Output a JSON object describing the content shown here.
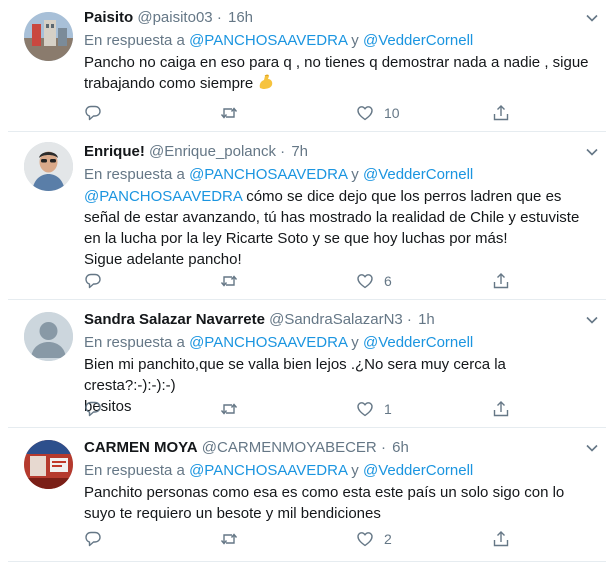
{
  "reply_prefix": "En respuesta a",
  "reply_joiner": "y",
  "tweets": [
    {
      "name": "Paisito",
      "handle": "@paisito03",
      "dot": "·",
      "time": "16h",
      "mentions": [
        "@PANCHOSAAVEDRA",
        "@VedderCornell"
      ],
      "text": "Pancho no caiga en eso para q , no tienes q demostrar nada a nadie , sigue trabajando como siempre",
      "emoji_icon": "flexed-biceps-icon",
      "like_count": "10",
      "avatar_color": "#b5504a"
    },
    {
      "name": "Enrique!",
      "handle": "@Enrique_polanck",
      "dot": "·",
      "time": "7h",
      "mentions": [
        "@PANCHOSAAVEDRA",
        "@VedderCornell"
      ],
      "text_mention": "@PANCHOSAAVEDRA",
      "text": " cómo se dice dejo que los perros ladren que es señal de estar avanzando, tú has mostrado la realidad de Chile y estuviste en la lucha por la ley Ricarte Soto y se que hoy luchas por más!\nSigue adelante pancho!",
      "like_count": "6",
      "avatar_color": "#d9dde0"
    },
    {
      "name": "Sandra Salazar Navarrete",
      "handle": "@SandraSalazarN3",
      "dot": "·",
      "time": "1h",
      "mentions": [
        "@PANCHOSAAVEDRA",
        "@VedderCornell"
      ],
      "text": "Bien mi panchito,que se valla bien lejos .¿No sera muy cerca la cresta?:-):-):-)\nbesitos",
      "like_count": "1",
      "avatar_color": "#ccd6dd"
    },
    {
      "name": "CARMEN MOYA",
      "handle": "@CARMENMOYABECER",
      "dot": "·",
      "time": "6h",
      "mentions": [
        "@PANCHOSAAVEDRA",
        "@VedderCornell"
      ],
      "text": "Panchito personas como esa es como esta este país un solo sigo con lo suyo te requiero un besote y mil bendiciones",
      "like_count": "2",
      "avatar_color": "#c0392b"
    }
  ],
  "icons": {
    "reply": "reply-icon",
    "retweet": "retweet-icon",
    "like": "heart-icon",
    "share": "share-icon",
    "more": "chevron-down-icon"
  }
}
